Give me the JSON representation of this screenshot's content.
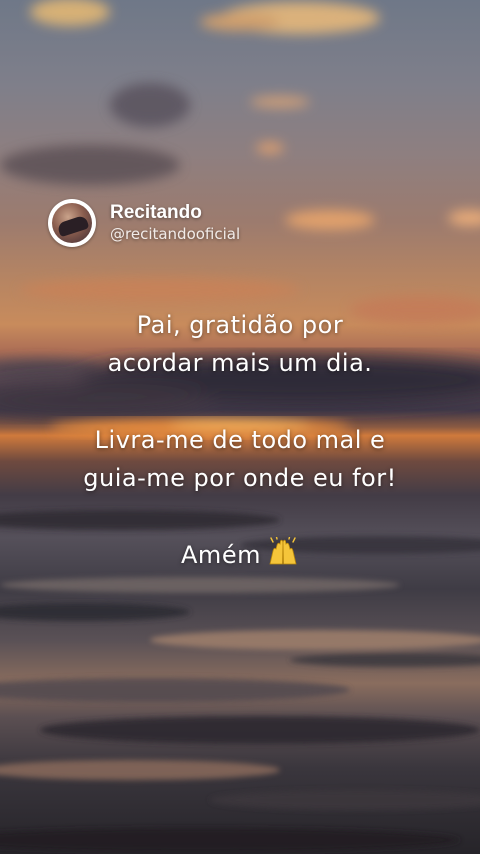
{
  "profile": {
    "name": "Recitando",
    "handle": "@recitandooficial"
  },
  "message": {
    "line1": "Pai, gratidão por",
    "line2": "acordar mais um dia.",
    "line3": "Livra-me de todo mal e",
    "line4": "guia-me por onde eu for!",
    "closing": "Amém"
  },
  "emoji": "raised-hands-icon"
}
